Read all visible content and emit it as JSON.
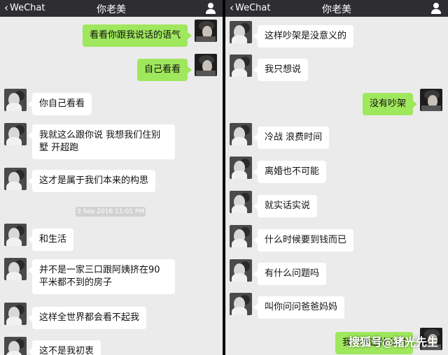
{
  "left": {
    "back_label": "WeChat",
    "title": "你老美",
    "messages": [
      {
        "side": "out",
        "text": "看看你跟我说话的语气"
      },
      {
        "side": "out",
        "text": "自己看看"
      },
      {
        "side": "in",
        "text": "你自己看看"
      },
      {
        "side": "in",
        "text": "我就这么跟你说 我想我们住别墅 开超跑"
      },
      {
        "side": "in",
        "text": "这才是属于我们本来的构思"
      },
      {
        "side": "in",
        "text": "和生活"
      },
      {
        "side": "in",
        "text": "并不是一家三口跟阿姨挤在90平米都不到的房子"
      },
      {
        "side": "in",
        "text": "这样全世界都会看不起我"
      },
      {
        "side": "in",
        "text": "这不是我初衷"
      }
    ],
    "timestamp": "3 Sep 2016 11:01 PM"
  },
  "right": {
    "back_label": "WeChat",
    "title": "你老美",
    "messages": [
      {
        "side": "in",
        "text": "这样吵架是没意义的"
      },
      {
        "side": "in",
        "text": "我只想说"
      },
      {
        "side": "out",
        "text": "没有吵架"
      },
      {
        "side": "in",
        "text": "冷战 浪费时间"
      },
      {
        "side": "in",
        "text": "离婚也不可能"
      },
      {
        "side": "in",
        "text": "就实话实说"
      },
      {
        "side": "in",
        "text": "什么时候要到钱而已"
      },
      {
        "side": "in",
        "text": "有什么问题吗"
      },
      {
        "side": "in",
        "text": "叫你问问爸爸妈妈"
      },
      {
        "side": "out",
        "text": "我不知道什么时"
      }
    ]
  },
  "watermark": "搜狐号@猪光先生",
  "colors": {
    "nav_bg": "#2e2e32",
    "chat_bg": "#ebebeb",
    "out_bubble": "#9fe75c",
    "in_bubble": "#ffffff"
  }
}
